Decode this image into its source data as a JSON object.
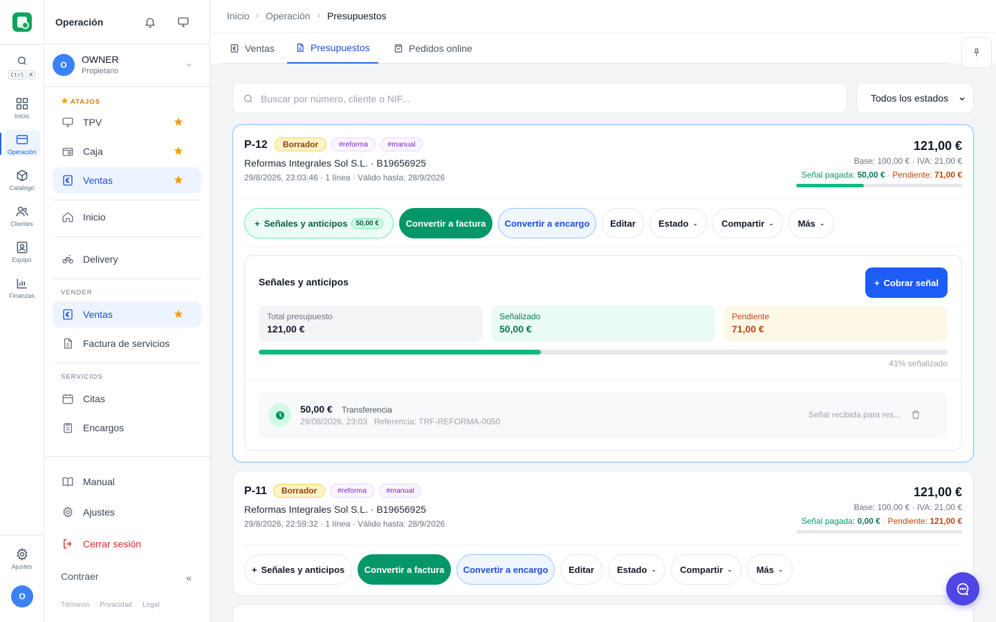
{
  "rail": {
    "search_keys": [
      "Ctrl",
      "K"
    ],
    "items": [
      {
        "label": "Inicio",
        "icon": "grid-icon"
      },
      {
        "label": "Operación",
        "icon": "card-icon"
      },
      {
        "label": "Catálogo",
        "icon": "box-icon"
      },
      {
        "label": "Clientes",
        "icon": "users-icon"
      },
      {
        "label": "Equipo",
        "icon": "id-badge-icon"
      },
      {
        "label": "Finanzas",
        "icon": "bar-chart-icon"
      }
    ],
    "settings_label": "Ajustes",
    "avatar_initial": "O"
  },
  "side": {
    "title": "Operación",
    "owner": {
      "initial": "O",
      "name": "OWNER",
      "role": "Propietario"
    },
    "shortcuts_label": "ATAJOS",
    "shortcuts": [
      {
        "label": "TPV"
      },
      {
        "label": "Caja"
      },
      {
        "label": "Ventas"
      }
    ],
    "inicio": "Inicio",
    "delivery": "Delivery",
    "vender_label": "VENDER",
    "vender": [
      {
        "label": "Ventas"
      },
      {
        "label": "Factura de servicios"
      }
    ],
    "servicios_label": "SERVICIOS",
    "servicios": [
      {
        "label": "Citas"
      },
      {
        "label": "Encargos"
      }
    ],
    "manual": "Manual",
    "ajustes": "Ajustes",
    "logout": "Cerrar sesión",
    "collapse": "Contraer",
    "legal": [
      "Términos",
      "Privacidad",
      "Legal"
    ]
  },
  "breadcrumb": [
    "Inicio",
    "Operación",
    "Presupuestos"
  ],
  "tabs": [
    {
      "label": "Ventas"
    },
    {
      "label": "Presupuestos"
    },
    {
      "label": "Pedidos online"
    }
  ],
  "search": {
    "placeholder": "Buscar por número, cliente o NIF..."
  },
  "status_filter": "Todos los estados",
  "quotes": [
    {
      "number": "P-12",
      "status": "Borrador",
      "tags": [
        "#reforma",
        "#manual"
      ],
      "client": "Reformas Integrales Sol S.L. · B19656925",
      "meta": "29/8/2026, 23:03:46 · 1 línea · Válido hasta: 28/9/2026",
      "total": "121,00 €",
      "base": "Base: 100,00 € · IVA: 21,00 €",
      "signal_label": "Señal pagada:",
      "signal_value": "50,00 €",
      "pending_label": "Pendiente:",
      "pending_value": "71,00 €",
      "paid_fraction": 0.41,
      "actions": {
        "signals": "Señales y anticipos",
        "signals_badge": "50,00 €",
        "invoice": "Convertir a factura",
        "order": "Convertir a encargo",
        "edit": "Editar",
        "state": "Estado",
        "share": "Compartir",
        "more": "Más"
      },
      "panel": {
        "title": "Señales y anticipos",
        "collect": "Cobrar señal",
        "total_label": "Total presupuesto",
        "total_value": "121,00 €",
        "signaled_label": "Señalizado",
        "signaled_value": "50,00 €",
        "pending_label": "Pendiente",
        "pending_value": "71,00 €",
        "percent_text": "41% señalizado",
        "payment": {
          "amount": "50,00 €",
          "method": "Transferencia",
          "detail": "29/08/2026, 23:03   Referencia: TRF-REFORMA-0050",
          "note": "Señal recibida para res..."
        }
      }
    },
    {
      "number": "P-11",
      "status": "Borrador",
      "tags": [
        "#reforma",
        "#manual"
      ],
      "client": "Reformas Integrales Sol S.L. · B19656925",
      "meta": "29/8/2026, 22:59:32 · 1 línea · Válido hasta: 28/9/2026",
      "total": "121,00 €",
      "base": "Base: 100,00 € · IVA: 21,00 €",
      "signal_label": "Señal pagada:",
      "signal_value": "0,00 €",
      "pending_label": "Pendiente:",
      "pending_value": "121,00 €",
      "paid_fraction": 0,
      "actions": {
        "signals": "Señales y anticipos",
        "invoice": "Convertir a factura",
        "order": "Convertir a encargo",
        "edit": "Editar",
        "state": "Estado",
        "share": "Compartir",
        "more": "Más"
      }
    }
  ],
  "colors": {
    "accent": "#2563eb",
    "green": "#059669",
    "star": "#f59e0b",
    "danger": "#dc2626"
  }
}
